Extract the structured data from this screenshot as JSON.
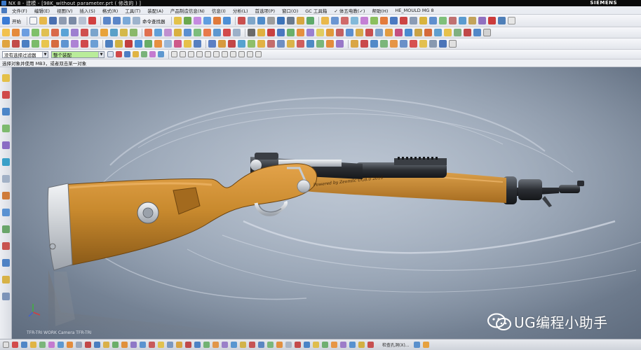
{
  "window": {
    "title": "NX 8 - 建模 - [98K_without parameter.prt  ( 修改的 ) ]",
    "brand": "SIEMENS"
  },
  "menu": {
    "items": [
      "文件(F)",
      "编辑(E)",
      "视图(V)",
      "插入(S)",
      "格式(R)",
      "工具(T)",
      "装配(A)",
      "产品制造信息(N)",
      "信息(I)",
      "分析(L)",
      "首选项(P)",
      "窗口(O)",
      "GC 工具箱",
      "✓ 体五电教(✓)",
      "帮助(H)",
      "HE_MOULD MG 8"
    ]
  },
  "toolbar1": {
    "start_label": "开始",
    "command_finder_label": "命令查找器"
  },
  "toolbar4": {
    "filter_value": "没有选择过滤器",
    "assembly_value": "整个装配"
  },
  "cue": {
    "text": "选择对象并使用 MB3，或者双击某一对象"
  },
  "viewport": {
    "engraving": "Powered by Zeomilc UG8.0 2016",
    "view_tag": "TFR-TRI WORK Camera TFR-TRI"
  },
  "watermark": {
    "text": "UG编程小助手"
  },
  "status": {
    "right_text": "检查孔洞(X)..."
  },
  "colors": {
    "stock_wood": "#c98a2e",
    "metal_dark": "#2b2e33",
    "viewport_bg": "#8896a8"
  }
}
